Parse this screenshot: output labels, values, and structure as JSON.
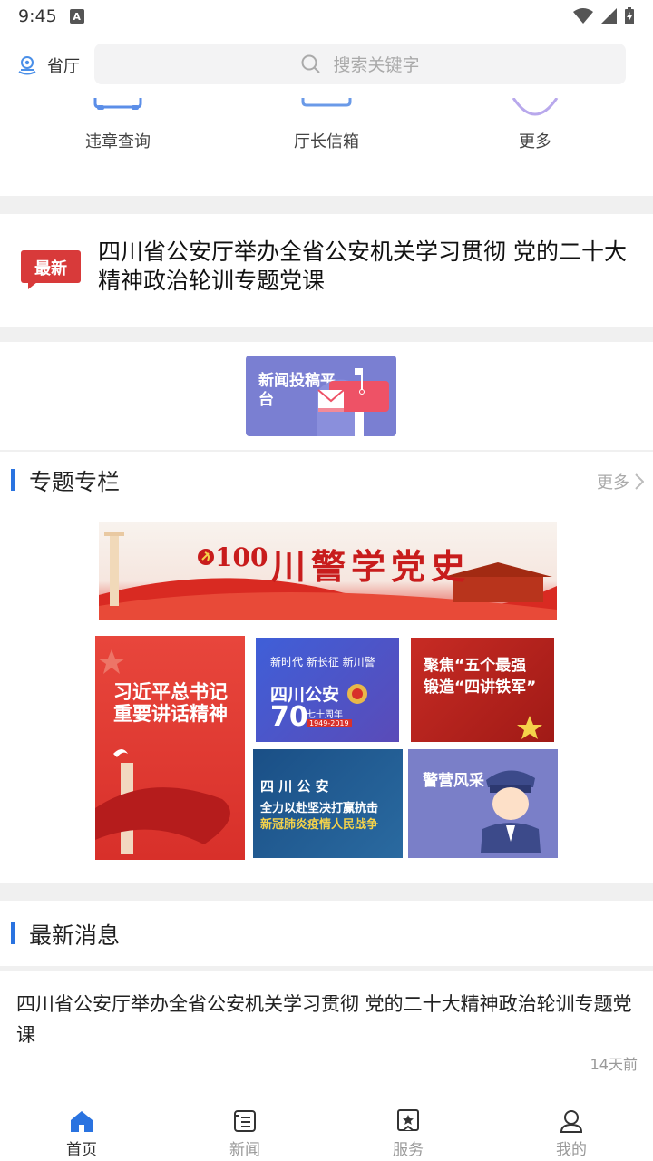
{
  "status_bar": {
    "time": "9:45",
    "notification_letter": "A"
  },
  "header": {
    "location_label": "省厅",
    "search_placeholder": "搜索关键字"
  },
  "quick_menu": [
    {
      "label": "违章查询",
      "icon": "car-icon"
    },
    {
      "label": "厅长信箱",
      "icon": "mailbox-icon"
    },
    {
      "label": "更多",
      "icon": "more-icon"
    }
  ],
  "latest": {
    "badge": "最新",
    "title": "四川省公安厅举办全省公安机关学习贯彻 党的二十大精神政治轮训专题党课"
  },
  "platform_banner": {
    "text": "新闻投稿平台"
  },
  "topics": {
    "title": "专题专栏",
    "more": "更多",
    "main_banner": {
      "badge": "100",
      "title": "川警学党史"
    },
    "tiles": [
      {
        "text": "习近平总书记重要讲话精神"
      },
      {
        "line1": "新时代 新长征 新川警",
        "line2": "四川公安",
        "number": "70",
        "sub": "七十周年",
        "years": "1949-2019"
      },
      {
        "line1": "聚焦“五个最强",
        "line2": "锻造“四讲铁军”"
      },
      {
        "line1": "四 川 公 安",
        "line2": "全力以赴坚决打赢抗击",
        "line3": "新冠肺炎疫情人民战争"
      },
      {
        "text": "警营风采"
      }
    ]
  },
  "news": {
    "title": "最新消息",
    "items": [
      {
        "title": "四川省公安厅举办全省公安机关学习贯彻 党的二十大精神政治轮训专题党课",
        "time": "14天前"
      }
    ]
  },
  "tabbar": [
    {
      "label": "首页",
      "icon": "home-icon",
      "active": true
    },
    {
      "label": "新闻",
      "icon": "news-icon",
      "active": false
    },
    {
      "label": "服务",
      "icon": "star-service-icon",
      "active": false
    },
    {
      "label": "我的",
      "icon": "user-icon",
      "active": false
    }
  ],
  "colors": {
    "accent": "#2a73e0",
    "badge_red": "#d83a3a",
    "platform_bg": "#7a7fd2"
  }
}
